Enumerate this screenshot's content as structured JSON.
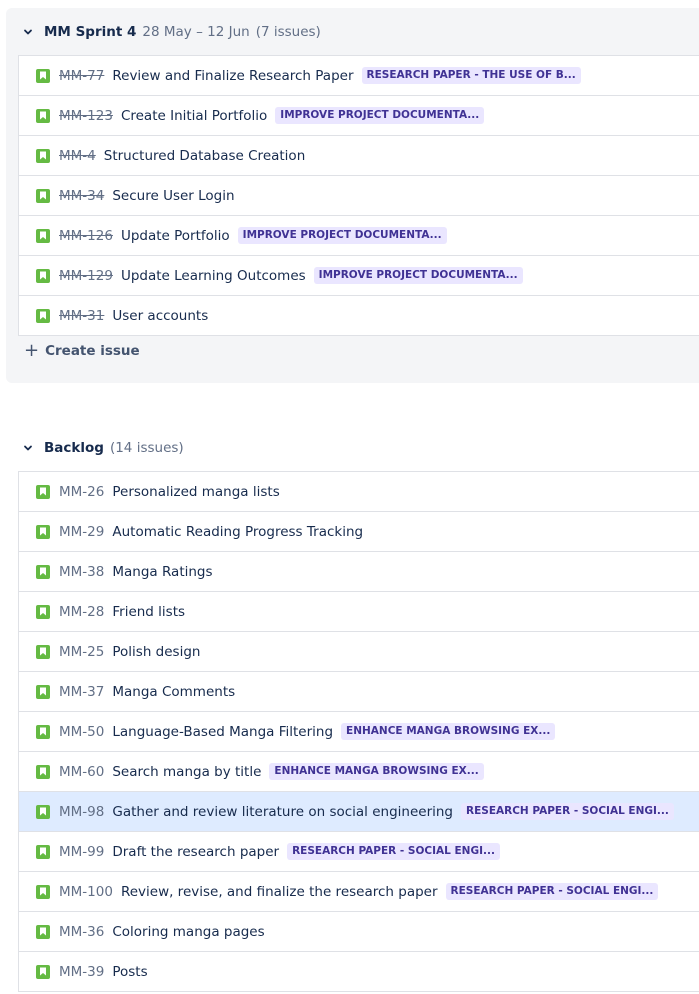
{
  "sprint": {
    "title": "MM Sprint 4",
    "dates": "28 May – 12 Jun",
    "count": "(7 issues)",
    "create_label": "Create issue",
    "issues": [
      {
        "key": "MM-77",
        "summary": "Review and Finalize Research Paper",
        "epic": "RESEARCH PAPER - THE USE OF B..."
      },
      {
        "key": "MM-123",
        "summary": "Create Initial Portfolio",
        "epic": "IMPROVE PROJECT DOCUMENTA..."
      },
      {
        "key": "MM-4",
        "summary": "Structured Database Creation",
        "epic": ""
      },
      {
        "key": "MM-34",
        "summary": "Secure User Login",
        "epic": ""
      },
      {
        "key": "MM-126",
        "summary": "Update Portfolio",
        "epic": "IMPROVE PROJECT DOCUMENTA..."
      },
      {
        "key": "MM-129",
        "summary": "Update Learning Outcomes",
        "epic": "IMPROVE PROJECT DOCUMENTA..."
      },
      {
        "key": "MM-31",
        "summary": "User accounts",
        "epic": ""
      }
    ]
  },
  "backlog": {
    "title": "Backlog",
    "count": "(14 issues)",
    "issues": [
      {
        "key": "MM-26",
        "summary": "Personalized manga lists",
        "epic": ""
      },
      {
        "key": "MM-29",
        "summary": "Automatic Reading Progress Tracking",
        "epic": ""
      },
      {
        "key": "MM-38",
        "summary": "Manga Ratings",
        "epic": ""
      },
      {
        "key": "MM-28",
        "summary": "Friend lists",
        "epic": ""
      },
      {
        "key": "MM-25",
        "summary": "Polish design",
        "epic": ""
      },
      {
        "key": "MM-37",
        "summary": "Manga Comments",
        "epic": ""
      },
      {
        "key": "MM-50",
        "summary": "Language-Based Manga Filtering",
        "epic": "ENHANCE MANGA BROWSING EX..."
      },
      {
        "key": "MM-60",
        "summary": "Search manga by title",
        "epic": "ENHANCE MANGA BROWSING EX..."
      },
      {
        "key": "MM-98",
        "summary": "Gather and review literature on social engineering",
        "epic": "RESEARCH PAPER - SOCIAL ENGI..."
      },
      {
        "key": "MM-99",
        "summary": "Draft the research paper",
        "epic": "RESEARCH PAPER - SOCIAL ENGI..."
      },
      {
        "key": "MM-100",
        "summary": "Review, revise, and finalize the research paper",
        "epic": "RESEARCH PAPER - SOCIAL ENGI..."
      },
      {
        "key": "MM-36",
        "summary": "Coloring manga pages",
        "epic": ""
      },
      {
        "key": "MM-39",
        "summary": "Posts",
        "epic": ""
      }
    ]
  },
  "colors": {
    "story_icon": "#65ba43",
    "epic_bg": "#eae6ff",
    "epic_text": "#403294",
    "selected_row": "#deebff"
  }
}
